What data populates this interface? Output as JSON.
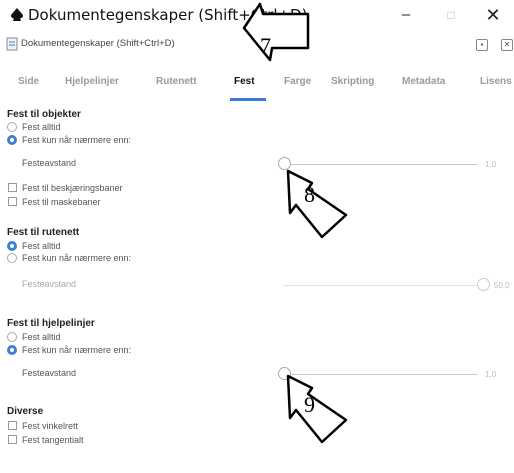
{
  "window": {
    "title": "Dokumentegenskaper  (Shift+Ctrl+D)",
    "minimize": "–",
    "maximize": "□",
    "close": "✕"
  },
  "dock": {
    "title": "Dokumentegenskaper (Shift+Ctrl+D)",
    "btn1": "▪",
    "btn2": "✕"
  },
  "tabs": [
    "Side",
    "Hjelpelinjer",
    "Rutenett",
    "Fest",
    "Farge",
    "Skripting",
    "Metadata",
    "Lisens"
  ],
  "active_tab": "Fest",
  "sections": {
    "objekter": {
      "title": "Fest til objekter",
      "opt_always": "Fest alltid",
      "opt_near": "Fest kun når nærmere enn:",
      "selected": "near",
      "distance_label": "Festeavstand",
      "distance_value": "1,0",
      "chk1": "Fest til beskjæringsbaner",
      "chk2": "Fest til maskebaner"
    },
    "rutenett": {
      "title": "Fest til rutenett",
      "opt_always": "Fest alltid",
      "opt_near": "Fest kun når nærmere enn:",
      "selected": "always",
      "distance_label": "Festeavstand",
      "distance_value": "50,0"
    },
    "hjelpelinjer": {
      "title": "Fest til hjelpelinjer",
      "opt_always": "Fest alltid",
      "opt_near": "Fest kun når nærmere enn:",
      "selected": "near",
      "distance_label": "Festeavstand",
      "distance_value": "1,0"
    },
    "diverse": {
      "title": "Diverse",
      "chk1": "Fest vinkelrett",
      "chk2": "Fest tangentialt"
    }
  },
  "annotations": {
    "n7": "7",
    "n8": "8",
    "n9": "9"
  }
}
